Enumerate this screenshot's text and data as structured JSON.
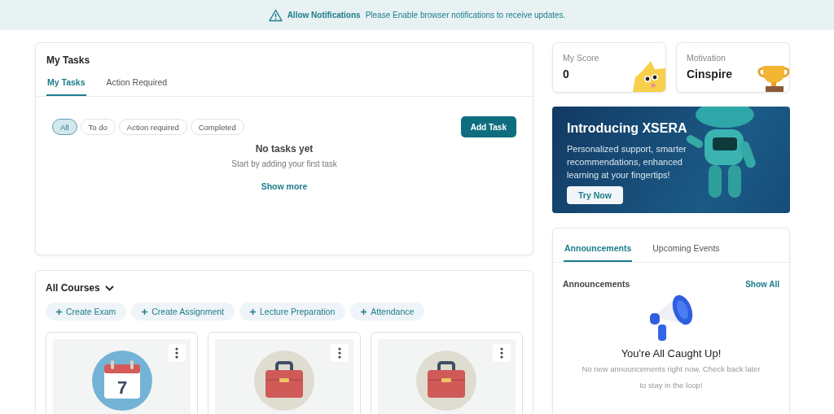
{
  "notification": {
    "title": "Allow Notifications",
    "message": "Please Enable browser notifications to receive updates."
  },
  "tasks_card": {
    "title": "My Tasks",
    "tabs": [
      {
        "label": "My Tasks",
        "selected": true
      },
      {
        "label": "Action Required",
        "selected": false
      }
    ],
    "filters": [
      {
        "label": "All",
        "selected": true
      },
      {
        "label": "To do",
        "selected": false
      },
      {
        "label": "Action required",
        "selected": false
      },
      {
        "label": "Completed",
        "selected": false
      }
    ],
    "add_button": "Add Task",
    "empty_title": "No tasks yet",
    "empty_message": "Start by adding your first task",
    "show_more": "Show more"
  },
  "courses": {
    "title": "All Courses",
    "actions": [
      {
        "label": "Create Exam"
      },
      {
        "label": "Create Assignment"
      },
      {
        "label": "Lecture Preparation"
      },
      {
        "label": "Attendance"
      }
    ],
    "cards": [
      {
        "kind": "calendar",
        "day": "7"
      },
      {
        "kind": "briefcase"
      },
      {
        "kind": "briefcase"
      }
    ]
  },
  "stats": [
    {
      "label": "My Score",
      "value": "0",
      "kind": "star"
    },
    {
      "label": "Motivation",
      "value": "Cinspire",
      "kind": "trophy"
    }
  ],
  "promo": {
    "title": "Introducing XSERA",
    "text": "Personalized support, smarter recommendations, enhanced learning at your fingertips!",
    "button": "Try Now"
  },
  "feed": {
    "tabs": [
      {
        "label": "Announcements",
        "selected": true
      },
      {
        "label": "Upcoming Events",
        "selected": false
      }
    ],
    "heading": "Announcements",
    "show_all": "Show All",
    "empty_title": "You're All Caught Up!",
    "empty_message": "No new announcements right now. Check back later to stay in the loop!"
  }
}
